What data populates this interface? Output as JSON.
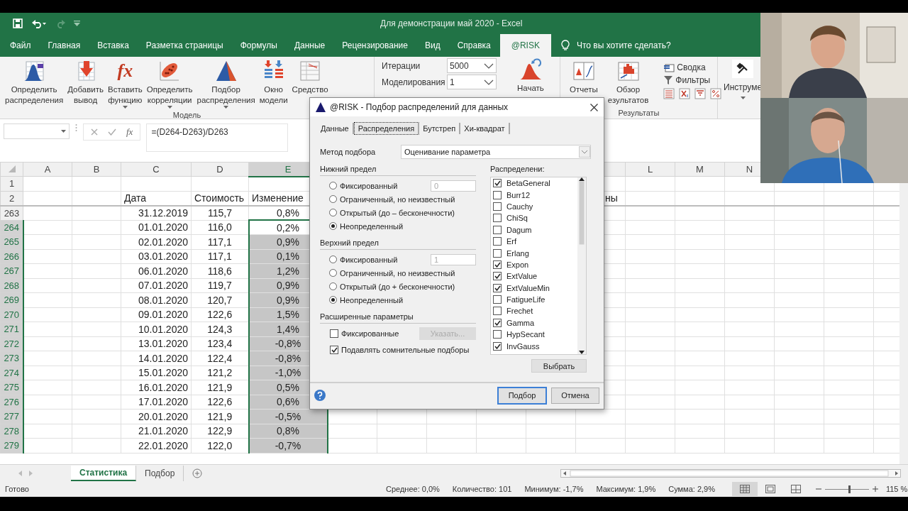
{
  "title_bar": {
    "title": "Для демонстрации май 2020  -  Excel"
  },
  "menu_tabs": [
    {
      "label": "Файл",
      "selected": false
    },
    {
      "label": "Главная",
      "selected": false
    },
    {
      "label": "Вставка",
      "selected": false
    },
    {
      "label": "Разметка страницы",
      "selected": false
    },
    {
      "label": "Формулы",
      "selected": false
    },
    {
      "label": "Данные",
      "selected": false
    },
    {
      "label": "Рецензирование",
      "selected": false
    },
    {
      "label": "Вид",
      "selected": false
    },
    {
      "label": "Справка",
      "selected": false
    },
    {
      "label": "@RISK",
      "selected": true
    }
  ],
  "tell_me": "Что вы хотите сделать?",
  "ribbon": {
    "model_group": {
      "label": "Модель",
      "buttons": [
        {
          "kind": "distribution",
          "label": "Определить\nраспределения",
          "dropdown": false
        },
        {
          "kind": "output",
          "label": "Добавить\nвывод",
          "dropdown": false
        },
        {
          "kind": "function",
          "glyph": "fx",
          "label": "Вставить\nфункцию",
          "dropdown": true
        },
        {
          "kind": "correlation",
          "label": "Определить\nкорреляции",
          "dropdown": true
        },
        {
          "kind": "fit",
          "label": "Подбор\nраспределения",
          "dropdown": true
        },
        {
          "kind": "model-window",
          "label": "Окно\nмодели",
          "dropdown": false
        },
        {
          "kind": "tool",
          "label": "Средство",
          "dropdown": false
        }
      ]
    },
    "simulation": {
      "iterations_label": "Итерации",
      "iterations": "5000",
      "simulations_label": "Моделирования",
      "simulations": "1",
      "start": "Начать"
    },
    "results_group": {
      "label": "Результаты",
      "buttons": [
        {
          "kind": "reports",
          "label": "Отчеты"
        },
        {
          "kind": "browse",
          "label": "Обзор\nезультатов"
        }
      ],
      "summary": "Сводка",
      "filters": "Фильтры"
    },
    "tools": "Инструме"
  },
  "formula_bar": {
    "fx": "fx",
    "formula": "=(D264-D263)/D263"
  },
  "sheet": {
    "columns_left": [
      {
        "label": "A",
        "selected": false
      },
      {
        "label": "B",
        "selected": false
      },
      {
        "label": "C",
        "selected": false
      },
      {
        "label": "D",
        "selected": false
      },
      {
        "label": "E",
        "selected": true
      }
    ],
    "columns_right": [
      {
        "label": "L",
        "selected": false
      },
      {
        "label": "M",
        "selected": false
      },
      {
        "label": "N",
        "selected": false
      }
    ],
    "rows": [
      {
        "number": "1",
        "kind": "blank"
      },
      {
        "number": "2",
        "kind": "header",
        "cells": [
          "Дата",
          "Стоимость",
          "Изменение"
        ],
        "overflow": "ны"
      },
      {
        "number": "263",
        "kind": "data",
        "date": "31.12.2019",
        "price": "115,7",
        "change": "0,8%",
        "selected": false,
        "active": false
      },
      {
        "number": "264",
        "kind": "data",
        "date": "01.01.2020",
        "price": "116,0",
        "change": "0,2%",
        "selected": true,
        "active": true
      },
      {
        "number": "265",
        "kind": "data",
        "date": "02.01.2020",
        "price": "117,1",
        "change": "0,9%",
        "selected": true,
        "active": false
      },
      {
        "number": "266",
        "kind": "data",
        "date": "03.01.2020",
        "price": "117,1",
        "change": "0,1%",
        "selected": true,
        "active": false
      },
      {
        "number": "267",
        "kind": "data",
        "date": "06.01.2020",
        "price": "118,6",
        "change": "1,2%",
        "selected": true,
        "active": false
      },
      {
        "number": "268",
        "kind": "data",
        "date": "07.01.2020",
        "price": "119,7",
        "change": "0,9%",
        "selected": true,
        "active": false
      },
      {
        "number": "269",
        "kind": "data",
        "date": "08.01.2020",
        "price": "120,7",
        "change": "0,9%",
        "selected": true,
        "active": false
      },
      {
        "number": "270",
        "kind": "data",
        "date": "09.01.2020",
        "price": "122,6",
        "change": "1,5%",
        "selected": true,
        "active": false
      },
      {
        "number": "271",
        "kind": "data",
        "date": "10.01.2020",
        "price": "124,3",
        "change": "1,4%",
        "selected": true,
        "active": false
      },
      {
        "number": "272",
        "kind": "data",
        "date": "13.01.2020",
        "price": "123,4",
        "change": "-0,8%",
        "selected": true,
        "active": false
      },
      {
        "number": "273",
        "kind": "data",
        "date": "14.01.2020",
        "price": "122,4",
        "change": "-0,8%",
        "selected": true,
        "active": false
      },
      {
        "number": "274",
        "kind": "data",
        "date": "15.01.2020",
        "price": "121,2",
        "change": "-1,0%",
        "selected": true,
        "active": false
      },
      {
        "number": "275",
        "kind": "data",
        "date": "16.01.2020",
        "price": "121,9",
        "change": "0,5%",
        "selected": true,
        "active": false
      },
      {
        "number": "276",
        "kind": "data",
        "date": "17.01.2020",
        "price": "122,6",
        "change": "0,6%",
        "selected": true,
        "active": false
      },
      {
        "number": "277",
        "kind": "data",
        "date": "20.01.2020",
        "price": "121,9",
        "change": "-0,5%",
        "selected": true,
        "active": false
      },
      {
        "number": "278",
        "kind": "data",
        "date": "21.01.2020",
        "price": "122,9",
        "change": "0,8%",
        "selected": true,
        "active": false
      },
      {
        "number": "279",
        "kind": "data",
        "date": "22.01.2020",
        "price": "122,0",
        "change": "-0,7%",
        "selected": true,
        "active": false
      }
    ]
  },
  "sheet_tabs": [
    {
      "label": "Статистика",
      "selected": true
    },
    {
      "label": "Подбор",
      "selected": false
    }
  ],
  "status_bar": {
    "ready": "Готово",
    "stats": [
      "Среднее: 0,0%",
      "Количество: 101",
      "Минимум: -1,7%",
      "Максимум: 1,9%",
      "Сумма: 2,9%"
    ],
    "views": [
      {
        "kind": "normal",
        "selected": true
      },
      {
        "kind": "layout",
        "selected": false
      },
      {
        "kind": "break",
        "selected": false
      }
    ],
    "zoom": {
      "level": 0.55,
      "reading": "115 %"
    }
  },
  "dialog": {
    "title": "@RISK - Подбор распределений для данных",
    "tabs": [
      {
        "label": "Данные",
        "selected": false
      },
      {
        "label": "Распределения",
        "selected": true
      },
      {
        "label": "Бутстреп",
        "selected": false
      },
      {
        "label": "Хи-квадрат",
        "selected": false
      }
    ],
    "method_label": "Метод подбора",
    "method": "Оценивание параметра",
    "limits": [
      {
        "title": "Нижний предел",
        "options": [
          {
            "label": "Фиксированный",
            "selected": false,
            "value": "0"
          },
          {
            "label": "Ограниченный, но неизвестный",
            "selected": false
          },
          {
            "label": "Открытый (до – бесконечности)",
            "selected": false
          },
          {
            "label": "Неопределенный",
            "selected": true
          }
        ]
      },
      {
        "title": "Верхний предел",
        "options": [
          {
            "label": "Фиксированный",
            "selected": false,
            "value": "1"
          },
          {
            "label": "Ограниченный, но неизвестный",
            "selected": false
          },
          {
            "label": "Открытый (до + бесконечности)",
            "selected": false
          },
          {
            "label": "Неопределенный",
            "selected": true
          }
        ]
      }
    ],
    "advanced": {
      "title": "Расширенные параметры",
      "options": [
        {
          "label": "Фиксированные",
          "checked": false,
          "button": "Указать...",
          "button_disabled": true
        },
        {
          "label": "Подавлять сомнительные подборы",
          "checked": true
        }
      ]
    },
    "distributions_label": "Распределени:",
    "distributions": [
      {
        "name": "BetaGeneral",
        "checked": true
      },
      {
        "name": "Burr12",
        "checked": false
      },
      {
        "name": "Cauchy",
        "checked": false
      },
      {
        "name": "ChiSq",
        "checked": false
      },
      {
        "name": "Dagum",
        "checked": false
      },
      {
        "name": "Erf",
        "checked": false
      },
      {
        "name": "Erlang",
        "checked": false
      },
      {
        "name": "Expon",
        "checked": true
      },
      {
        "name": "ExtValue",
        "checked": true
      },
      {
        "name": "ExtValueMin",
        "checked": true
      },
      {
        "name": "FatigueLife",
        "checked": false
      },
      {
        "name": "Frechet",
        "checked": false
      },
      {
        "name": "Gamma",
        "checked": true
      },
      {
        "name": "HypSecant",
        "checked": false
      },
      {
        "name": "InvGauss",
        "checked": true
      }
    ],
    "select_button": "Выбрать",
    "buttons": [
      {
        "label": "Подбор",
        "default": true
      },
      {
        "label": "Отмена",
        "default": false
      }
    ]
  }
}
